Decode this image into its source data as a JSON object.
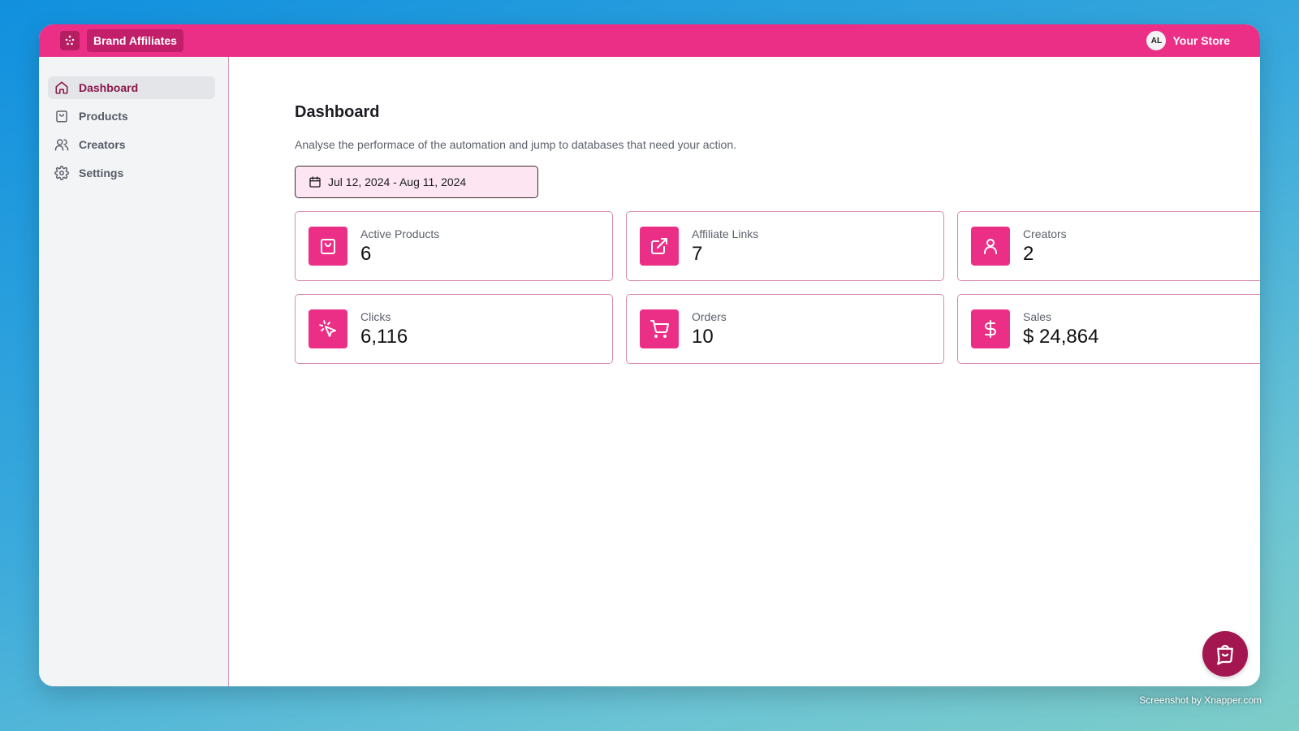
{
  "app": {
    "brand_name": "Brand Affiliates",
    "user_initials": "AL",
    "store_name": "Your Store",
    "accent_color": "#ec2f86"
  },
  "sidebar": {
    "items": [
      {
        "label": "Dashboard",
        "icon": "home-icon",
        "active": true
      },
      {
        "label": "Products",
        "icon": "shopping-bag-icon",
        "active": false
      },
      {
        "label": "Creators",
        "icon": "users-icon",
        "active": false
      },
      {
        "label": "Settings",
        "icon": "gear-icon",
        "active": false
      }
    ]
  },
  "main": {
    "title": "Dashboard",
    "description": "Analyse the performace of the automation and jump to databases that need your action.",
    "date_range": "Jul 12, 2024 - Aug 11, 2024",
    "cards": [
      {
        "label": "Active Products",
        "value": "6",
        "icon": "shopping-bag-icon"
      },
      {
        "label": "Affiliate Links",
        "value": "7",
        "icon": "external-link-icon"
      },
      {
        "label": "Creators",
        "value": "2",
        "icon": "user-icon"
      },
      {
        "label": "Clicks",
        "value": "6,116",
        "icon": "cursor-click-icon"
      },
      {
        "label": "Orders",
        "value": "10",
        "icon": "shopping-cart-icon"
      },
      {
        "label": "Sales",
        "value": "$ 24,864",
        "icon": "dollar-icon"
      }
    ]
  },
  "watermark": "Screenshot by Xnapper.com"
}
